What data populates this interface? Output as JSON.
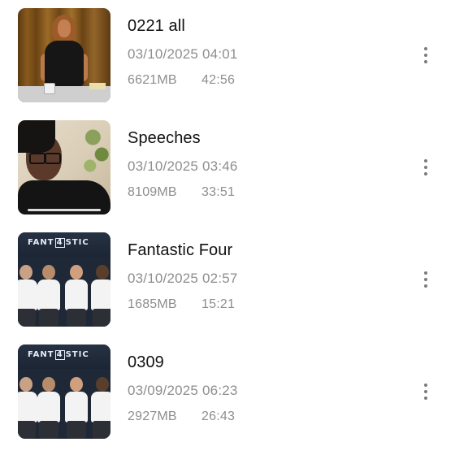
{
  "videos": [
    {
      "title": "0221 all",
      "date": "03/10/2025 04:01",
      "size": "6621MB",
      "duration": "42:56",
      "thumbnail_icon": "video-thumbnail-studio-host"
    },
    {
      "title": "Speeches",
      "date": "03/10/2025 03:46",
      "size": "8109MB",
      "duration": "33:51",
      "thumbnail_icon": "video-thumbnail-woman-glasses"
    },
    {
      "title": "Fantastic Four",
      "date": "03/10/2025 02:57",
      "size": "1685MB",
      "duration": "15:21",
      "thumbnail_icon": "video-thumbnail-fantastic-four-panel",
      "thumbnail_logo": "FANT4STIC"
    },
    {
      "title": "0309",
      "date": "03/09/2025 06:23",
      "size": "2927MB",
      "duration": "26:43",
      "thumbnail_icon": "video-thumbnail-fantastic-four-panel",
      "thumbnail_logo": "FANT4STIC"
    }
  ],
  "more_icon": "more-vertical-icon",
  "colors": {
    "title": "#111111",
    "meta": "#8e8e8e",
    "background": "#ffffff"
  }
}
